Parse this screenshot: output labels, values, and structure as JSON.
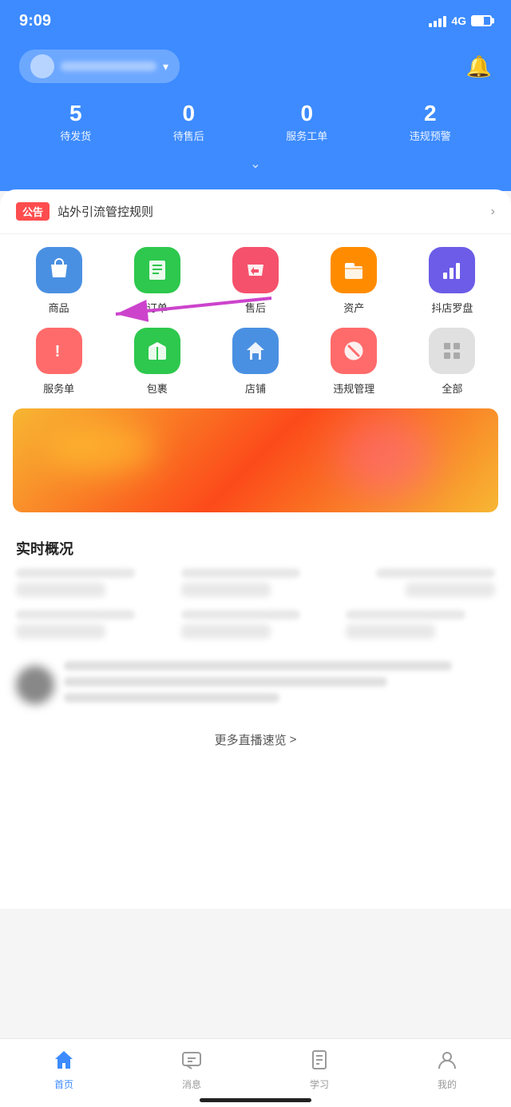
{
  "statusBar": {
    "time": "9:09",
    "network": "4G"
  },
  "header": {
    "storeName": "",
    "bellLabel": "notifications"
  },
  "stats": [
    {
      "id": "pending-shipment",
      "number": "5",
      "label": "待发货"
    },
    {
      "id": "pending-aftersale",
      "number": "0",
      "label": "待售后"
    },
    {
      "id": "service-order",
      "number": "0",
      "label": "服务工单"
    },
    {
      "id": "violation-warning",
      "number": "2",
      "label": "违规预警"
    }
  ],
  "announcement": {
    "tag": "公告",
    "text": "站外引流管控规则",
    "arrowLabel": ">"
  },
  "menuItems": [
    {
      "id": "product",
      "label": "商品",
      "icon": "🛍️",
      "colorClass": "icon-product"
    },
    {
      "id": "order",
      "label": "订单",
      "icon": "📋",
      "colorClass": "icon-order"
    },
    {
      "id": "aftersale",
      "label": "售后",
      "icon": "↩️",
      "colorClass": "icon-aftersale"
    },
    {
      "id": "asset",
      "label": "资产",
      "icon": "📁",
      "colorClass": "icon-asset"
    },
    {
      "id": "compass",
      "label": "抖店罗盘",
      "icon": "📊",
      "colorClass": "icon-compass"
    },
    {
      "id": "service",
      "label": "服务单",
      "icon": "❗",
      "colorClass": "icon-service"
    },
    {
      "id": "package",
      "label": "包裹",
      "icon": "📦",
      "colorClass": "icon-package"
    },
    {
      "id": "shop",
      "label": "店铺",
      "icon": "🏪",
      "colorClass": "icon-shop"
    },
    {
      "id": "violation",
      "label": "违规管理",
      "icon": "🚫",
      "colorClass": "icon-violation"
    },
    {
      "id": "all",
      "label": "全部",
      "icon": "⊞",
      "colorClass": "icon-all"
    }
  ],
  "realtimeSection": {
    "title": "实时概况"
  },
  "moreLive": {
    "text": "更多直播速览",
    "arrow": ">"
  },
  "bottomNav": [
    {
      "id": "home",
      "label": "首页",
      "icon": "⌂",
      "active": true
    },
    {
      "id": "message",
      "label": "消息",
      "icon": "💬",
      "active": false
    },
    {
      "id": "learn",
      "label": "学习",
      "icon": "📖",
      "active": false
    },
    {
      "id": "mine",
      "label": "我的",
      "icon": "👤",
      "active": false
    }
  ]
}
